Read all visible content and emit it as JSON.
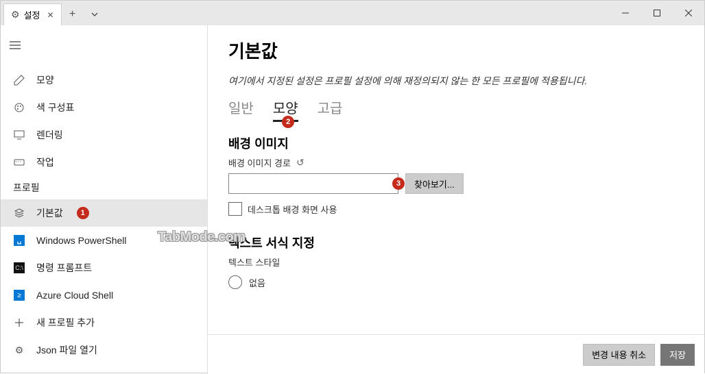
{
  "title_bar": {
    "tab_title": "설정",
    "watermark": "TabMode.com"
  },
  "sidebar": {
    "items": [
      {
        "label": "모양",
        "icon": "pencil-icon"
      },
      {
        "label": "색 구성표",
        "icon": "palette-icon"
      },
      {
        "label": "렌더링",
        "icon": "monitor-icon"
      },
      {
        "label": "작업",
        "icon": "keyboard-icon"
      }
    ],
    "profiles_header": "프로필",
    "profile_items": [
      {
        "label": "기본값",
        "icon": "layers-icon",
        "selected": true,
        "badge": "1"
      },
      {
        "label": "Windows PowerShell",
        "icon": "ps-icon"
      },
      {
        "label": "명령 프롬프트",
        "icon": "cmd-icon"
      },
      {
        "label": "Azure Cloud Shell",
        "icon": "azure-icon"
      },
      {
        "label": "새 프로필 추가",
        "icon": "plus-icon"
      },
      {
        "label": "Json 파일 열기",
        "icon": "gear-icon"
      }
    ]
  },
  "content": {
    "title": "기본값",
    "description": "여기에서 지정된 설정은 프로필 설정에 의해 재정의되지 않는 한 모든 프로필에 적용됩니다.",
    "tabs": [
      {
        "label": "일반",
        "active": false
      },
      {
        "label": "모양",
        "active": true,
        "badge": "2"
      },
      {
        "label": "고급",
        "active": false
      }
    ],
    "bg_section": {
      "title": "배경 이미지",
      "path_label": "배경 이미지 경로",
      "path_value": "",
      "browse_label": "찾아보기...",
      "browse_badge": "3",
      "checkbox_label": "데스크톱 배경 화면 사용",
      "checkbox_checked": false
    },
    "text_section": {
      "title": "텍스트 서식 지정",
      "style_label": "텍스트 스타일",
      "option_none": "없음"
    },
    "footer": {
      "cancel": "변경 내용 취소",
      "save": "저장"
    }
  }
}
